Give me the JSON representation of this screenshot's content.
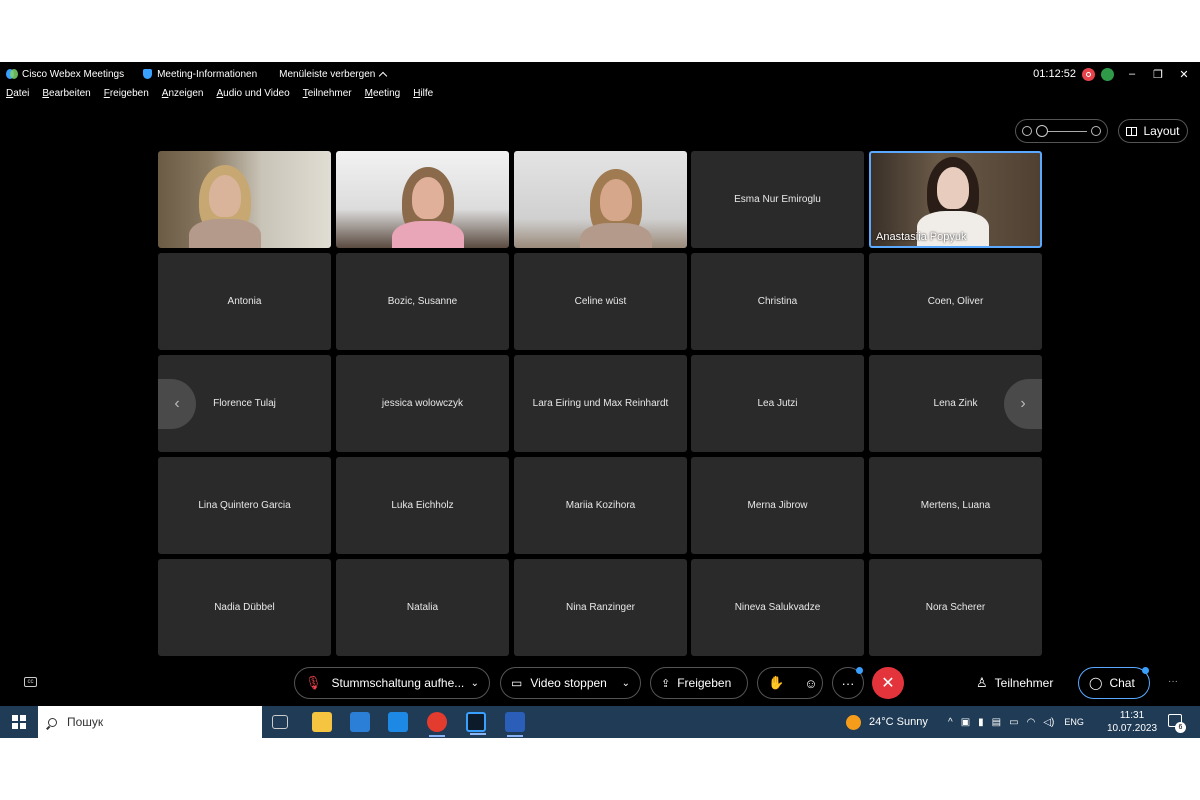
{
  "titlebar": {
    "app_name": "Cisco Webex Meetings",
    "meeting_info": "Meeting-Informationen",
    "hide_menu": "Menüleiste verbergen",
    "elapsed_time": "01:12:52",
    "minimize": "–",
    "restore": "❐",
    "close": "✕"
  },
  "menubar": [
    "Datei",
    "Bearbeiten",
    "Freigeben",
    "Anzeigen",
    "Audio und Video",
    "Teilnehmer",
    "Meeting",
    "Hilfe"
  ],
  "view_controls": {
    "layout_label": "Layout"
  },
  "participants": [
    {
      "name": "",
      "video": true
    },
    {
      "name": "",
      "video": true
    },
    {
      "name": "",
      "video": true
    },
    {
      "name": "Esma Nur Emiroglu",
      "video": false
    },
    {
      "name": "Anastasiia Popyuk",
      "video": true,
      "active_speaker": true
    },
    {
      "name": "Antonia",
      "video": false
    },
    {
      "name": "Bozic, Susanne",
      "video": false
    },
    {
      "name": "Celine wüst",
      "video": false
    },
    {
      "name": "Christina",
      "video": false
    },
    {
      "name": "Coen, Oliver",
      "video": false
    },
    {
      "name": "Florence Tulaj",
      "video": false
    },
    {
      "name": "jessica wolowczyk",
      "video": false
    },
    {
      "name": "Lara Eiring und Max Reinhardt",
      "video": false
    },
    {
      "name": "Lea Jutzi",
      "video": false
    },
    {
      "name": "Lena Zink",
      "video": false
    },
    {
      "name": "Lina Quintero Garcia",
      "video": false
    },
    {
      "name": "Luka Eichholz",
      "video": false
    },
    {
      "name": "Mariia Kozihora",
      "video": false
    },
    {
      "name": "Merna Jibrow",
      "video": false
    },
    {
      "name": "Mertens, Luana",
      "video": false
    },
    {
      "name": "Nadia Dübbel",
      "video": false
    },
    {
      "name": "Natalia",
      "video": false
    },
    {
      "name": "Nina Ranzinger",
      "video": false
    },
    {
      "name": "Nineva Salukvadze",
      "video": false
    },
    {
      "name": "Nora Scherer",
      "video": false
    }
  ],
  "controls": {
    "unmute_label": "Stummschaltung aufhe...",
    "video_label": "Video stoppen",
    "share_label": "Freigeben",
    "participants_label": "Teilnehmer",
    "chat_label": "Chat",
    "more_label": "···"
  },
  "taskbar": {
    "search_placeholder": "Пошук",
    "weather": "24°C  Sunny",
    "language": "ENG",
    "time": "11:31",
    "date": "10.07.2023",
    "notification_count": "6"
  },
  "colors": {
    "end_call": "#e3343c",
    "active_border": "#5aa9ff",
    "taskbar": "#1f3b55"
  }
}
